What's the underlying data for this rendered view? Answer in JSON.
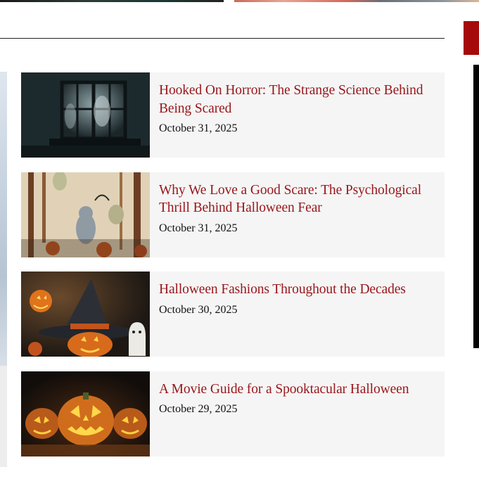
{
  "articles": [
    {
      "title": "Hooked On Horror: The Strange Science Behind Being Scared",
      "date": "October 31, 2025",
      "thumb_icon": "haunted-window-image"
    },
    {
      "title": "Why We Love a Good Scare: The Psychological Thrill Behind Halloween Fear",
      "date": "October 31, 2025",
      "thumb_icon": "ghosts-forest-image"
    },
    {
      "title": "Halloween Fashions Throughout the Decades",
      "date": "October 30, 2025",
      "thumb_icon": "witch-hat-pumpkin-image"
    },
    {
      "title": "A Movie Guide for a Spooktacular Halloween",
      "date": "October 29, 2025",
      "thumb_icon": "jack-o-lanterns-image"
    }
  ],
  "colors": {
    "title": "#98161a",
    "card_bg": "#f5f5f5",
    "accent": "#a60a0a"
  }
}
